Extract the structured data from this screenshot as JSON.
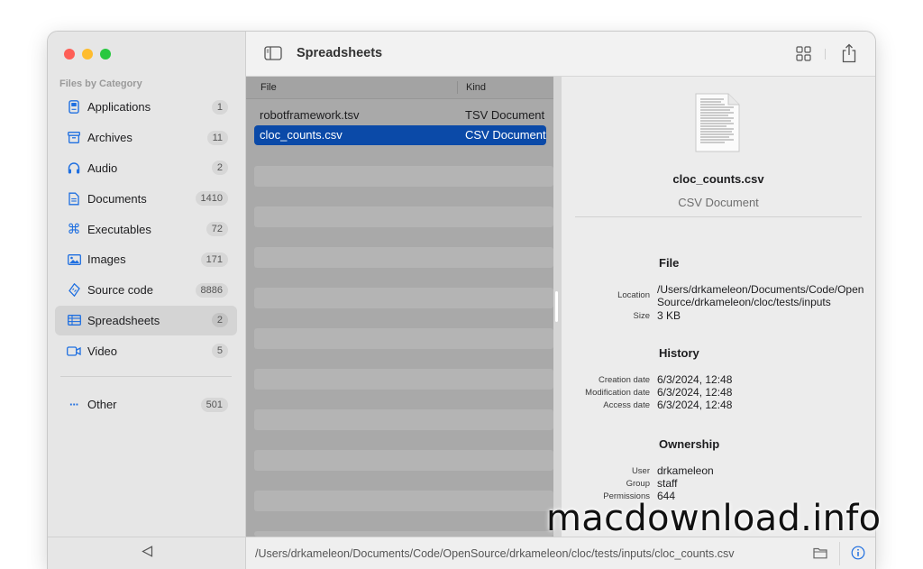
{
  "sidebar": {
    "header": "Files by Category",
    "items": [
      {
        "label": "Applications",
        "count": "1",
        "icon": "app-icon"
      },
      {
        "label": "Archives",
        "count": "11",
        "icon": "archive-icon"
      },
      {
        "label": "Audio",
        "count": "2",
        "icon": "headphones-icon"
      },
      {
        "label": "Documents",
        "count": "1410",
        "icon": "document-icon"
      },
      {
        "label": "Executables",
        "count": "72",
        "icon": "command-icon"
      },
      {
        "label": "Images",
        "count": "171",
        "icon": "photo-icon"
      },
      {
        "label": "Source code",
        "count": "8886",
        "icon": "source-code-icon"
      },
      {
        "label": "Spreadsheets",
        "count": "2",
        "icon": "table-icon",
        "selected": true
      },
      {
        "label": "Video",
        "count": "5",
        "icon": "video-icon"
      }
    ],
    "other": {
      "label": "Other",
      "count": "501",
      "icon": "ellipsis-icon"
    }
  },
  "toolbar": {
    "title": "Spreadsheets"
  },
  "filelist": {
    "columns": {
      "file": "File",
      "kind": "Kind"
    },
    "rows": [
      {
        "file": "robotframework.tsv",
        "kind": "TSV Document"
      },
      {
        "file": "cloc_counts.csv",
        "kind": "CSV Document",
        "selected": true
      }
    ]
  },
  "inspector": {
    "name": "cloc_counts.csv",
    "kind": "CSV Document",
    "file_section": "File",
    "location_label": "Location",
    "location_value": "/Users/drkameleon/Documents/Code/OpenSource/drkameleon/cloc/tests/inputs",
    "size_label": "Size",
    "size_value": "3 KB",
    "history_section": "History",
    "creation_label": "Creation date",
    "creation_value": "6/3/2024, 12:48",
    "modification_label": "Modification date",
    "modification_value": "6/3/2024, 12:48",
    "access_label": "Access date",
    "access_value": "6/3/2024, 12:48",
    "ownership_section": "Ownership",
    "user_label": "User",
    "user_value": "drkameleon",
    "group_label": "Group",
    "group_value": "staff",
    "permissions_label": "Permissions",
    "permissions_value": "644"
  },
  "pathbar": {
    "path": "/Users/drkameleon/Documents/Code/OpenSource/drkameleon/cloc/tests/inputs/cloc_counts.csv"
  },
  "watermark": "macdownload.info",
  "colors": {
    "accent": "#1f6fe0",
    "selection": "#0b4aa8"
  }
}
